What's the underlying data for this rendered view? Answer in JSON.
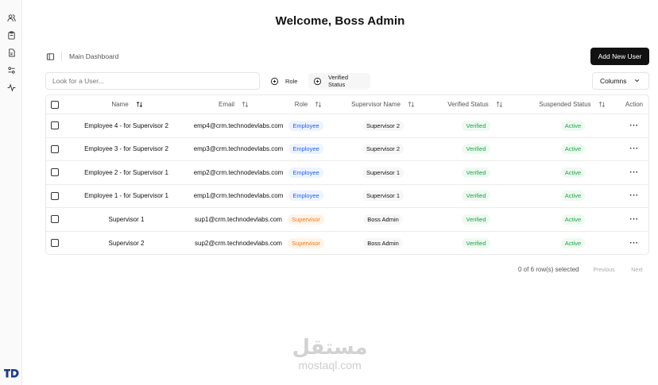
{
  "header": {
    "title": "Welcome, Boss Admin"
  },
  "breadcrumb": {
    "label": "Main Dashboard"
  },
  "sidebar": {
    "icons": [
      "users-icon",
      "clipboard-icon",
      "document-icon",
      "sliders-icon",
      "activity-icon"
    ],
    "logo_text": "TD"
  },
  "toolbar": {
    "add_button_label": "Add New User",
    "search_placeholder": "Look for a User...",
    "filter_role_label": "Role",
    "filter_verified_label": "Verified Status",
    "columns_label": "Columns"
  },
  "table": {
    "headers": {
      "name": "Name",
      "email": "Email",
      "role": "Role",
      "supervisor": "Supervisor Name",
      "verified": "Verified Status",
      "suspended": "Suspended Status",
      "action": "Action"
    },
    "rows": [
      {
        "name": "Employee 4 - for Supervisor 2",
        "email": "emp4@crm.technodevlabs.com",
        "role": "Employee",
        "supervisor": "Supervisor 2",
        "verified": "Verified",
        "suspended": "Active",
        "action": "···"
      },
      {
        "name": "Employee 3 - for Supervisor 2",
        "email": "emp3@crm.technodevlabs.com",
        "role": "Employee",
        "supervisor": "Supervisor 2",
        "verified": "Verified",
        "suspended": "Active",
        "action": "···"
      },
      {
        "name": "Employee 2 - for Supervisor 1",
        "email": "emp2@crm.technodevlabs.com",
        "role": "Employee",
        "supervisor": "Supervisor 1",
        "verified": "Verified",
        "suspended": "Active",
        "action": "···"
      },
      {
        "name": "Employee 1 - for Supervisor 1",
        "email": "emp1@crm.technodevlabs.com",
        "role": "Employee",
        "supervisor": "Supervisor 1",
        "verified": "Verified",
        "suspended": "Active",
        "action": "···"
      },
      {
        "name": "Supervisor 1",
        "email": "sup1@crm.technodevlabs.com",
        "role": "Supervisor",
        "supervisor": "Boss Admin",
        "verified": "Verified",
        "suspended": "Active",
        "action": "···"
      },
      {
        "name": "Supervisor 2",
        "email": "sup2@crm.technodevlabs.com",
        "role": "Supervisor",
        "supervisor": "Boss Admin",
        "verified": "Verified",
        "suspended": "Active",
        "action": "···"
      }
    ]
  },
  "pagination": {
    "selection_text": "0 of 6 row(s) selected",
    "previous_label": "Previous",
    "next_label": "Next"
  },
  "watermark": {
    "arabic": "مستقل",
    "latin": "mostaql.com"
  },
  "colors": {
    "primary": "#111111",
    "employee": "#2563eb",
    "supervisor": "#ea7a1a",
    "success": "#22a04a"
  }
}
